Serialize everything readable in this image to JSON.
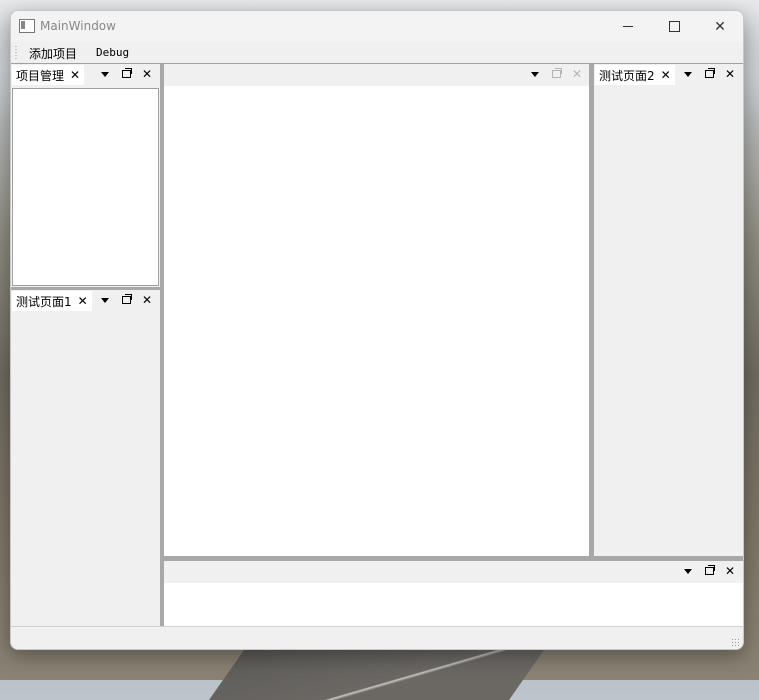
{
  "window": {
    "title": "MainWindow"
  },
  "menubar": {
    "items": [
      {
        "label": "添加项目"
      },
      {
        "label": "Debug"
      }
    ]
  },
  "docks": {
    "project": {
      "tab_label": "项目管理"
    },
    "test1": {
      "tab_label": "测试页面1"
    },
    "test2": {
      "tab_label": "测试页面2"
    }
  },
  "icons": {
    "app": "app-window-icon",
    "minimize": "minimize-icon",
    "maximize": "maximize-icon",
    "close": "close-icon",
    "menu": "dock-menu-arrow-icon",
    "float": "dock-float-icon"
  }
}
